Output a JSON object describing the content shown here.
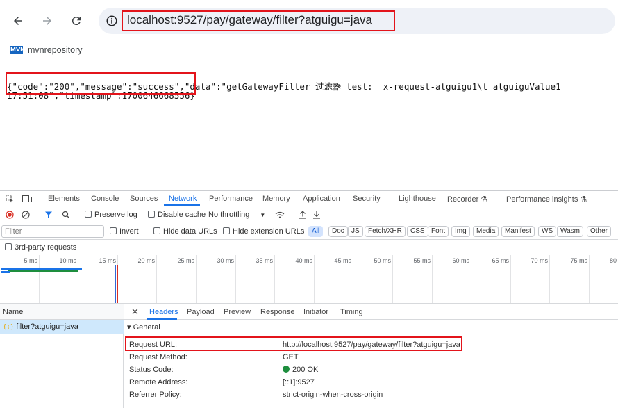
{
  "browser": {
    "url": "localhost:9527/pay/gateway/filter?atguigu=java",
    "bookmark": {
      "icon_text": "MVN",
      "label": "mvnrepository"
    }
  },
  "page": {
    "json_line1": "{\"code\":\"200\",\"message\":\"success\",\"data\":\"getGatewayFilter 过滤器 test:  x-request-atguigu1\\t atguiguValue1",
    "json_line2": "17:51:08\",\"timestamp\":1700646668556}"
  },
  "devtools": {
    "tabs": [
      "Elements",
      "Console",
      "Sources",
      "Network",
      "Performance",
      "Memory",
      "Application",
      "Security",
      "Lighthouse",
      "Recorder ⚗",
      "Performance insights ⚗"
    ],
    "active_tab": "Network",
    "toolbar": {
      "preserve_log": "Preserve log",
      "disable_cache": "Disable cache",
      "throttling": "No throttling"
    },
    "filter": {
      "placeholder": "Filter",
      "invert": "Invert",
      "hide_data_urls": "Hide data URLs",
      "hide_extension_urls": "Hide extension URLs",
      "chips": [
        "All",
        "Doc",
        "JS",
        "Fetch/XHR",
        "CSS",
        "Font",
        "Img",
        "Media",
        "Manifest",
        "WS",
        "Wasm",
        "Other"
      ],
      "third_party": "3rd-party requests"
    },
    "timeline_ticks": [
      "5 ms",
      "10 ms",
      "15 ms",
      "20 ms",
      "25 ms",
      "30 ms",
      "35 ms",
      "40 ms",
      "45 ms",
      "50 ms",
      "55 ms",
      "60 ms",
      "65 ms",
      "70 ms",
      "75 ms",
      "80"
    ],
    "requests": {
      "header": "Name",
      "rows": [
        {
          "icon": "{;}",
          "name": "filter?atguigu=java"
        }
      ]
    },
    "detail": {
      "tabs": [
        "Headers",
        "Payload",
        "Preview",
        "Response",
        "Initiator",
        "Timing"
      ],
      "active_tab": "Headers",
      "section": "▾ General",
      "fields": [
        {
          "key": "Request URL:",
          "value": "http://localhost:9527/pay/gateway/filter?atguigu=java"
        },
        {
          "key": "Request Method:",
          "value": "GET"
        },
        {
          "key": "Status Code:",
          "value": "200 OK"
        },
        {
          "key": "Remote Address:",
          "value": "[::1]:9527"
        },
        {
          "key": "Referrer Policy:",
          "value": "strict-origin-when-cross-origin"
        }
      ]
    }
  },
  "colors": {
    "accent": "#1a73e8",
    "highlight_border": "#e3141b",
    "status_ok": "#1e8e3e"
  }
}
